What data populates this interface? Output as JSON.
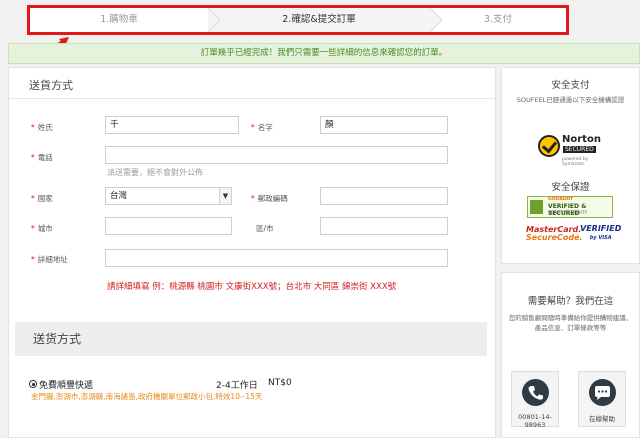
{
  "steps": [
    {
      "label": "1.購物車"
    },
    {
      "label": "2.確認&提交訂單"
    },
    {
      "label": "3.支付"
    }
  ],
  "notice": "訂單幾乎已經完成！我們只需要一些詳細的信息來確認您的訂單。",
  "shipping_form": {
    "title": "送貨方式",
    "required_mark": "*",
    "fields": {
      "last_name": {
        "label": "姓氏",
        "value": "千"
      },
      "first_name": {
        "label": "名字",
        "value": "顏"
      },
      "phone": {
        "label": "電話",
        "value": "",
        "hint": "派送需要，絕不會對外公佈"
      },
      "country": {
        "label": "國家",
        "value": "台灣"
      },
      "postal_code": {
        "label": "郵政編碼",
        "value": ""
      },
      "city": {
        "label": "城市",
        "value": ""
      },
      "district": {
        "label": "區/市",
        "value": ""
      },
      "address": {
        "label": "詳細地址",
        "value": ""
      }
    },
    "address_example": "請詳細填寫 例：桃源縣 桃園市 文康街XXX號；台北市 大同區 錦崇街 XXX號"
  },
  "shipping_method": {
    "title": "送货方式",
    "option": {
      "name": "免費順豐快遞",
      "days": "2-4工作日",
      "price": "NT$0",
      "note": "金門縣,澎湖市,澎湖縣,南海諸島,政府機關單位郵政小包,時效10--15天"
    }
  },
  "sidebar": {
    "secure_pay": {
      "title": "安全支付",
      "text": "SOUFEEL已經通過以下安全機構認證"
    },
    "norton": {
      "word": "Norton",
      "secured": "SECURED",
      "by": "powered by Symantec"
    },
    "guarantee": {
      "title": "安全保證"
    },
    "godaddy": {
      "brand": "GODADDY",
      "main": "VERIFIED & SECURED",
      "sub": "VERIFY SECURITY"
    },
    "mastercard": {
      "line1": "MasterCard.",
      "line2": "SecureCode."
    },
    "visa": {
      "line1": "VERIFIED",
      "line2": "by VISA"
    },
    "help": {
      "title": "需要幫助？我們在這",
      "text": "您的銷售顧問隨時準備給你提供購物建議、產品信息、訂單條款等等",
      "phone": "00801-14-98963",
      "chat": "在線幫助"
    }
  }
}
